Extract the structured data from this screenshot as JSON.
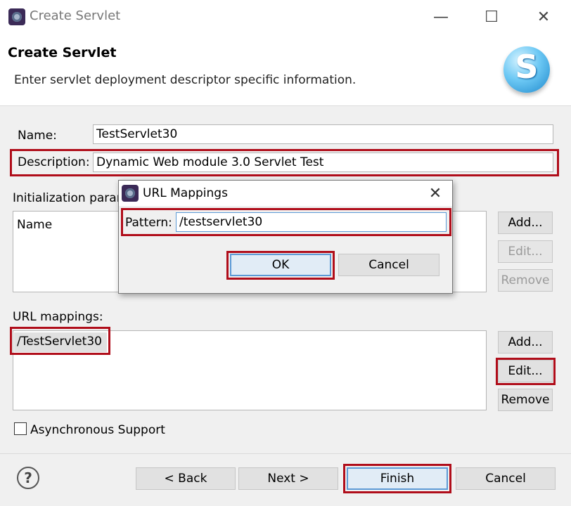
{
  "window": {
    "title": "Create Servlet",
    "minimize_glyph": "—",
    "maximize_glyph": "☐",
    "close_glyph": "✕"
  },
  "header": {
    "title": "Create Servlet",
    "description": "Enter servlet deployment descriptor specific information.",
    "logo_letter": "S"
  },
  "form": {
    "name_label": "Name:",
    "name_value": "TestServlet30",
    "description_label": "Description:",
    "description_value": "Dynamic Web module 3.0 Servlet Test",
    "init_params_label": "Initialization param",
    "init_params_column": "Name",
    "init_add": "Add...",
    "init_edit": "Edit...",
    "init_remove": "Remove",
    "url_mappings_label": "URL mappings:",
    "url_mappings": [
      "/TestServlet30"
    ],
    "url_add": "Add...",
    "url_edit": "Edit...",
    "url_remove": "Remove",
    "async_label": "Asynchronous Support",
    "async_checked": false
  },
  "footer": {
    "help_glyph": "?",
    "back": "< Back",
    "next": "Next >",
    "finish": "Finish",
    "cancel": "Cancel"
  },
  "dialog": {
    "title": "URL Mappings",
    "close_glyph": "✕",
    "pattern_label": "Pattern:",
    "pattern_value": "/testservlet30",
    "ok": "OK",
    "cancel": "Cancel"
  },
  "colors": {
    "highlight": "#b00d1a",
    "dialog_default_border": "#5c9ad6"
  }
}
